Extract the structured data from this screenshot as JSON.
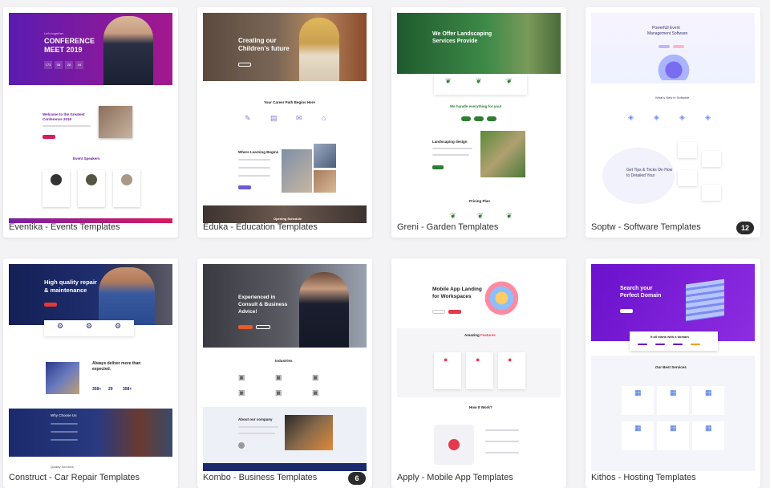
{
  "cards": [
    {
      "label": "Eventika - Events Templates",
      "badge": null,
      "preview": {
        "hero_tag": "Let's together",
        "hero_title_1": "CONFERENCE",
        "hero_title_2": "MEET 2019",
        "countdown": [
          "173",
          "08",
          "28",
          "44"
        ],
        "welcome_1": "Welcome to the Greatest",
        "welcome_2": "Conference 2019",
        "speakers": "Event Speakers"
      }
    },
    {
      "label": "Eduka - Education Templates",
      "badge": null,
      "preview": {
        "hero_title_1": "Creating our",
        "hero_title_2": "Children's future",
        "section": "Your Career Path Begins Here",
        "where": "Where Learning Begins",
        "opening": "Opening Schedule"
      }
    },
    {
      "label": "Greni - Garden Templates",
      "badge": null,
      "preview": {
        "hero_title_1": "We Offer Landscaping",
        "hero_title_2": "Services Provide",
        "handle": "We handle everything for you!",
        "landscaping": "Landscaping design",
        "pricing": "Pricing Plan"
      }
    },
    {
      "label": "Soptw - Software Templates",
      "badge": "12",
      "preview": {
        "hero_title_1": "Powerfull Event",
        "hero_title_2": "Management Software",
        "whats_new": "What's New in Software",
        "tips_1": "Get Tips & Tricks On How",
        "tips_2": "to Detailed Your"
      }
    },
    {
      "label": "Construct - Car Repair Templates",
      "badge": null,
      "preview": {
        "hero_title_1": "High quality repair",
        "hero_title_2": "& maintenance",
        "deliver_1": "Always deliver more than",
        "deliver_2": "expected.",
        "stats": [
          "358+",
          "29",
          "358+"
        ],
        "why": "Why Choose Us",
        "services": "Quality Services"
      }
    },
    {
      "label": "Kombo - Business Templates",
      "badge": "6",
      "preview": {
        "hero_title_1": "Experienced in",
        "hero_title_2": "Consult & Business",
        "hero_title_3": "Advice!",
        "industries": "Industries",
        "about": "About our company"
      }
    },
    {
      "label": "Apply - Mobile App Templates",
      "badge": null,
      "preview": {
        "hero_title_1": "Mobile App Landing",
        "hero_title_2": "for Workspaces",
        "amazing_1": "Amazing",
        "amazing_2": "Features",
        "how": "How It Work?"
      }
    },
    {
      "label": "Kithos - Hosting Templates",
      "badge": null,
      "preview": {
        "hero_title_1": "Search your",
        "hero_title_2": "Perfect Domain",
        "domain": "It all starts with a domain",
        "best": "Our Best Services"
      }
    }
  ],
  "colors": {
    "eventika_a": "#7b1fa2",
    "eventika_b": "#d81b60",
    "greni_green": "#2e7d32",
    "construct_navy": "#1a2a6c",
    "kithos_a": "#6a11cb",
    "kithos_b": "#8e2de2",
    "apply_red": "#e53950"
  }
}
